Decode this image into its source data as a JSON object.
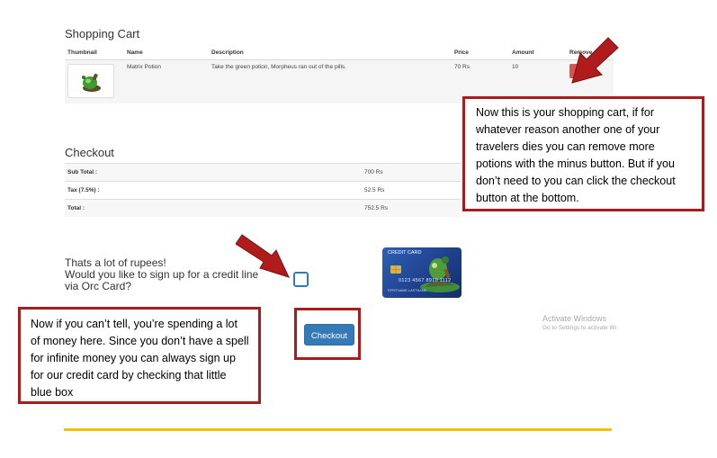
{
  "cart": {
    "title": "Shopping Cart",
    "columns": [
      "Thumbnail",
      "Name",
      "Description",
      "Price",
      "Amount",
      "Remove"
    ],
    "rows": [
      {
        "name": "Matrix Potion",
        "description": "Take the green potion, Morpheus ran out of the pills.",
        "price": "70 Rs",
        "amount": "10",
        "remove_label": "–"
      }
    ]
  },
  "checkout": {
    "title": "Checkout",
    "rows": [
      {
        "label": "Sub Total :",
        "value": "700 Rs"
      },
      {
        "label": "Tax (7.5%) :",
        "value": "52.5 Rs"
      },
      {
        "label": "Total :",
        "value": "752.5 Rs"
      }
    ]
  },
  "credit": {
    "line1": "Thats a lot of rupees!",
    "line2": "Would you like to sign up for a credit line",
    "line3": "via Orc Card?",
    "card_label": "CREDIT CARD",
    "card_number": "0123 4567 8910 1112",
    "card_holder": "FIRSTNAME LASTNAME"
  },
  "checkout_button": "Checkout",
  "callouts": {
    "cart_note": "Now this is your shopping cart, if for whatever reason another one of your travelers dies you can remove more potions with the minus button. But if you don’t need to you can click the checkout button at the bottom.",
    "money_note": "Now if you can’t tell, you’re spending a lot of money here. Since you don’t have a spell for infinite money you can always sign up for our credit card by checking that little blue box"
  },
  "watermark": {
    "title": "Activate Windows",
    "subtitle": "Go to Settings to activate Wi"
  },
  "colors": {
    "callout_border": "#a81c1c",
    "remove_button": "#d9534f",
    "checkout_button": "#337ab7",
    "checkbox_border": "#2e7bbf",
    "divider": "#f5c000"
  }
}
